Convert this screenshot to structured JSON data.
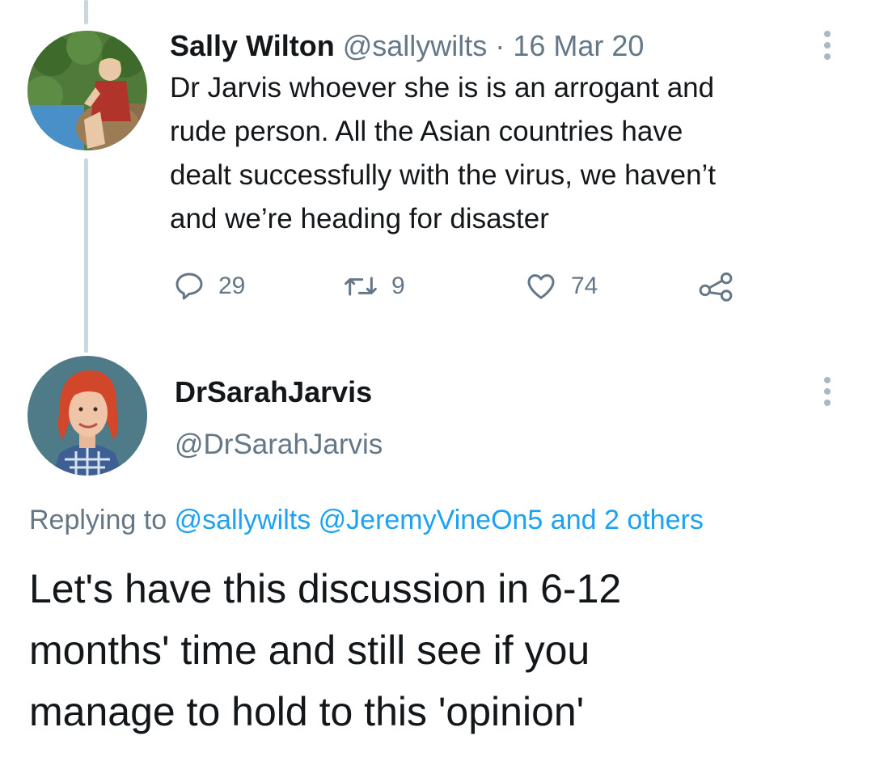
{
  "tweet1": {
    "display_name": "Sally Wilton",
    "handle": "@sallywilts",
    "separator": "·",
    "date": "16 Mar 20",
    "text_lines": [
      "Dr Jarvis whoever she is is an arrogant and",
      "rude person. All the Asian countries have",
      "dealt successfully with the virus, we haven’t",
      "and we’re heading for disaster"
    ],
    "actions": {
      "replies": "29",
      "retweets": "9",
      "likes": "74"
    },
    "icons": [
      "reply-icon",
      "retweet-icon",
      "like-icon",
      "share-icon",
      "more-options-icon"
    ]
  },
  "tweet2": {
    "display_name": "DrSarahJarvis",
    "handle": "@DrSarahJarvis",
    "replying_prefix": "Replying to",
    "replying_to": [
      "@sallywilts",
      "@JeremyVineOn5"
    ],
    "replying_suffix": "and 2 others",
    "text_lines": [
      "Let's have this discussion in 6-12",
      "months' time and still see if you",
      "manage to hold to this 'opinion'"
    ],
    "icons": [
      "more-options-icon"
    ]
  },
  "colors": {
    "text": "#14171a",
    "muted": "#657786",
    "link": "#1da1f2",
    "thread_line": "#ccd6dd"
  }
}
